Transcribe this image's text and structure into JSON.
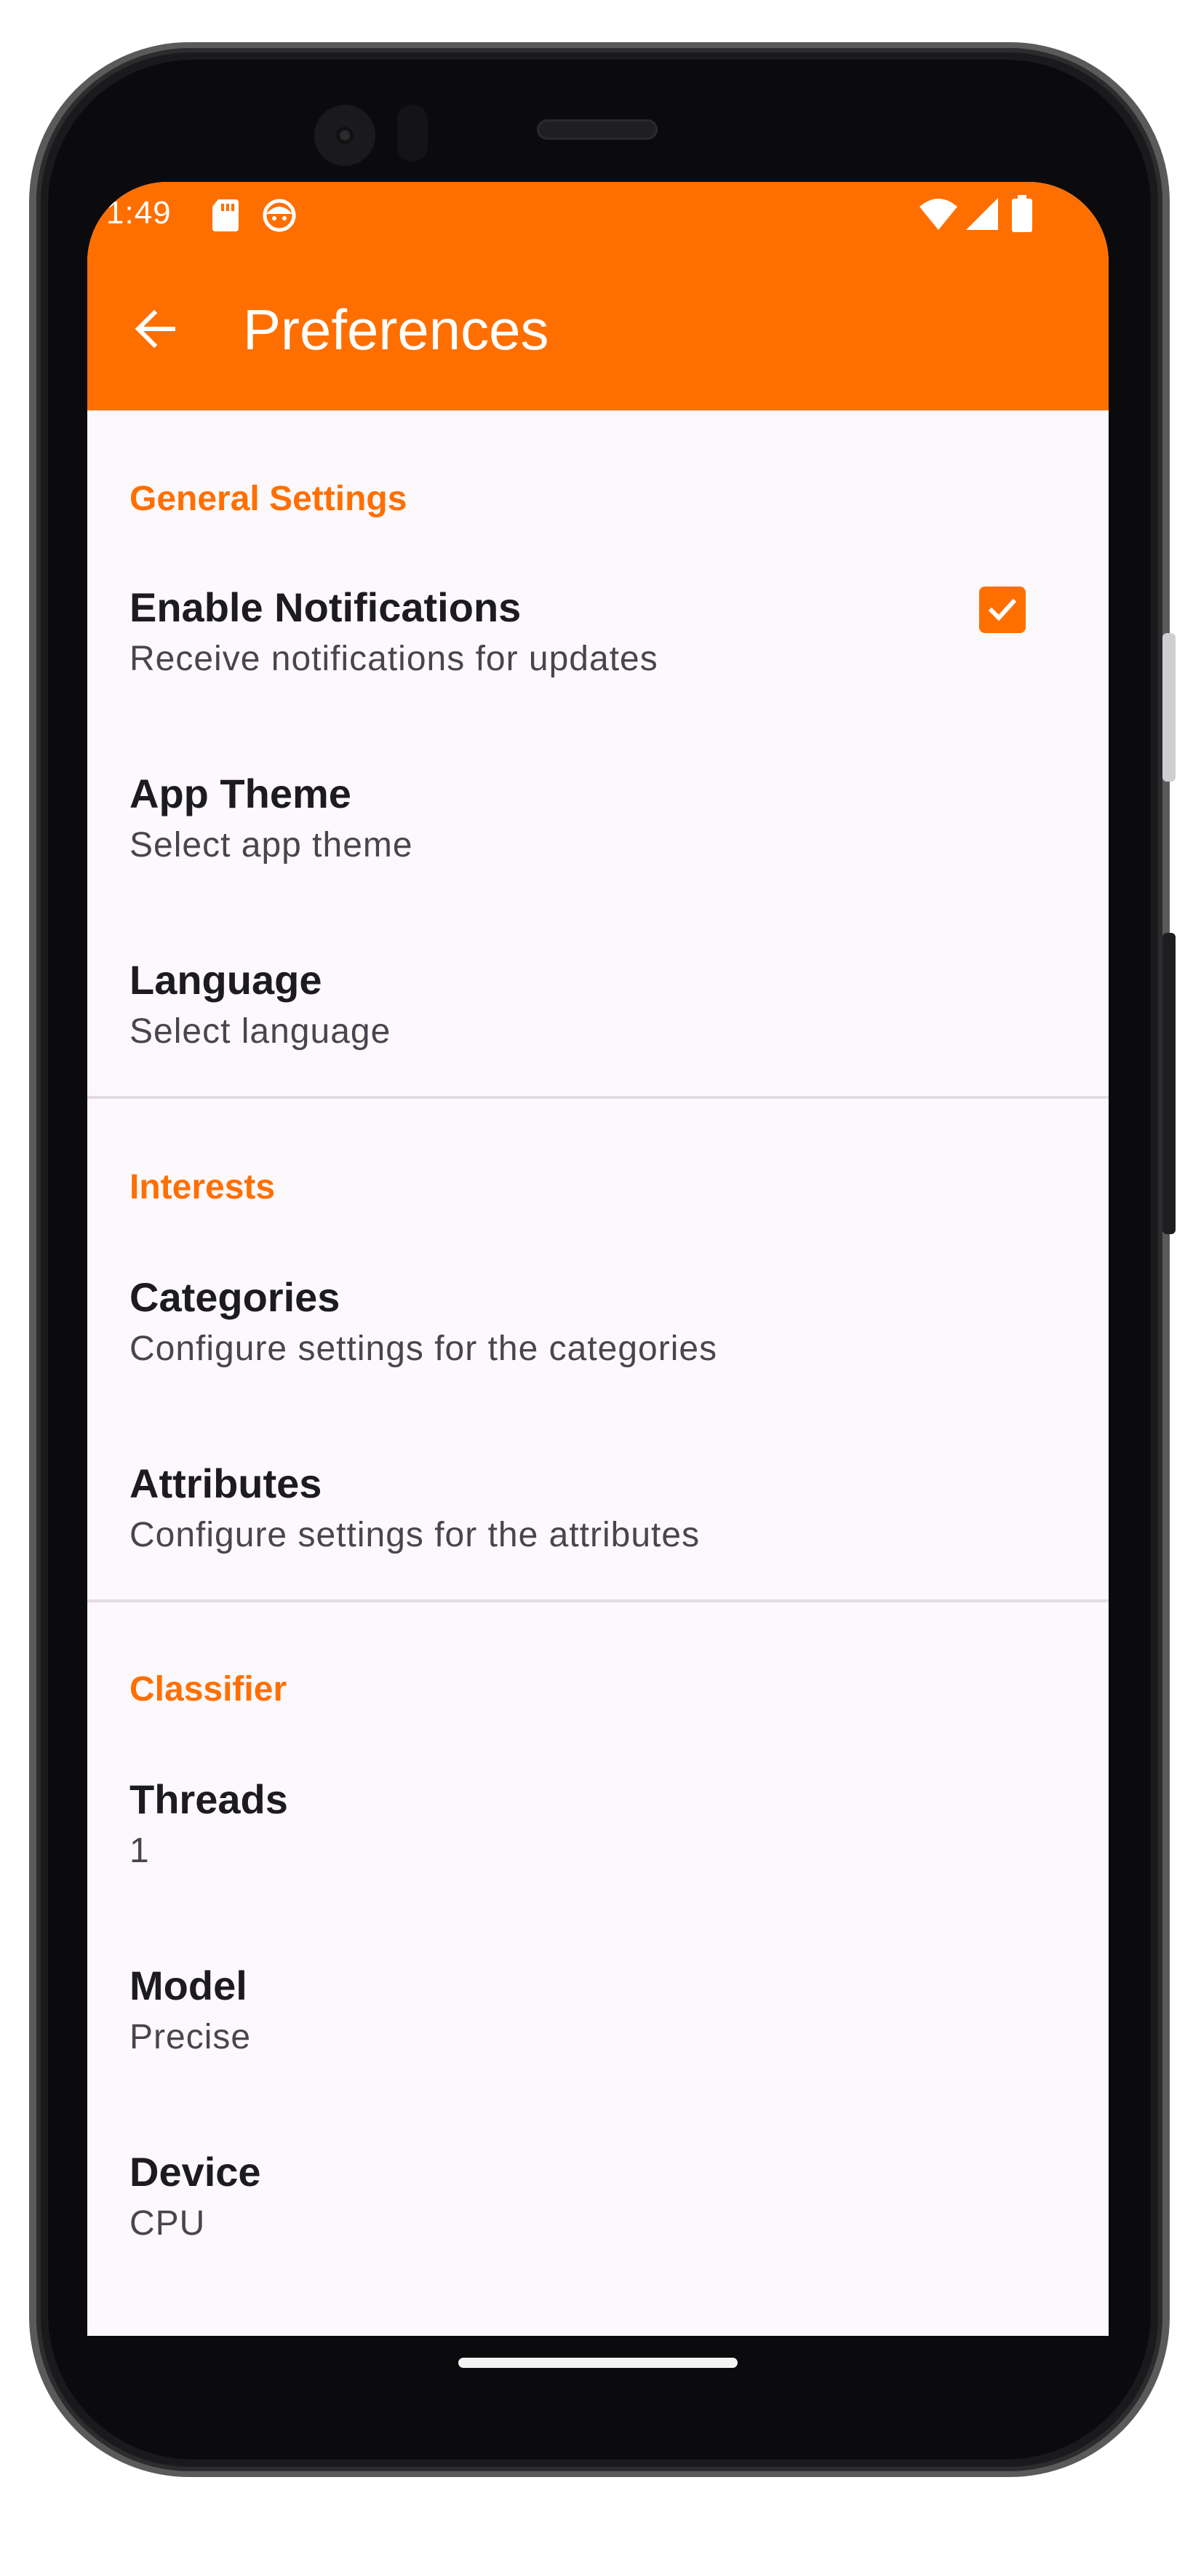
{
  "statusbar": {
    "time": "1:49",
    "icons": [
      "sd-card-icon",
      "face-icon",
      "wifi-icon",
      "signal-icon",
      "battery-icon"
    ]
  },
  "appbar": {
    "back_icon": "arrow-back-icon",
    "title": "Preferences"
  },
  "colors": {
    "accent": "#ff6f00",
    "background": "#fcf8fb",
    "title_text": "#1c1b1f",
    "summary_text": "#49454f",
    "divider": "#e3dde2"
  },
  "sections": [
    {
      "title": "General Settings",
      "items": [
        {
          "title": "Enable Notifications",
          "summary": "Receive notifications for updates",
          "checked": true
        },
        {
          "title": "App Theme",
          "summary": "Select app theme"
        },
        {
          "title": "Language",
          "summary": "Select language"
        }
      ]
    },
    {
      "title": "Interests",
      "items": [
        {
          "title": "Categories",
          "summary": "Configure settings for the categories"
        },
        {
          "title": "Attributes",
          "summary": "Configure settings for the attributes"
        }
      ]
    },
    {
      "title": "Classifier",
      "items": [
        {
          "title": "Threads",
          "summary": "1"
        },
        {
          "title": "Model",
          "summary": "Precise"
        },
        {
          "title": "Device",
          "summary": "CPU"
        }
      ]
    }
  ]
}
